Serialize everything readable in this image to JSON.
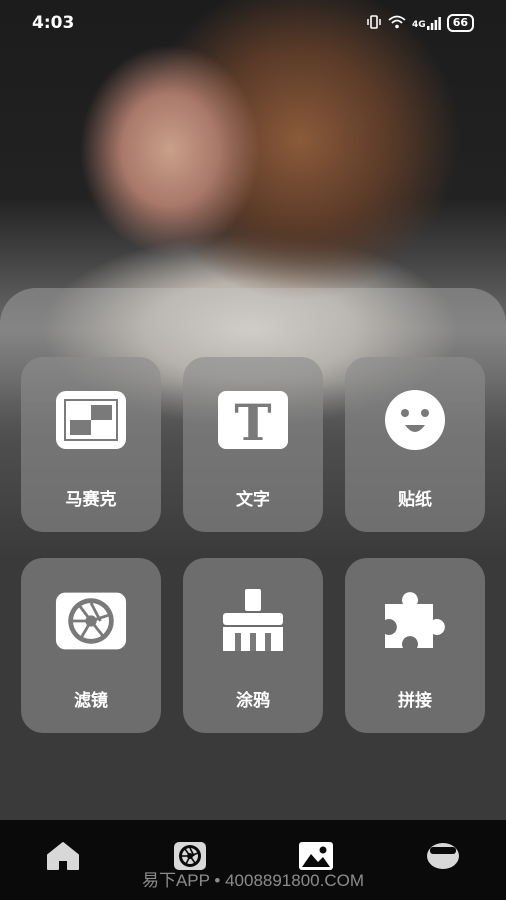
{
  "status_bar": {
    "time": "4:03",
    "network": "4G",
    "battery": "66"
  },
  "tools": [
    {
      "label": "马赛克",
      "icon": "mosaic-icon"
    },
    {
      "label": "文字",
      "icon": "text-icon",
      "glyph": "T"
    },
    {
      "label": "贴纸",
      "icon": "smiley-sticker-icon"
    },
    {
      "label": "滤镜",
      "icon": "aperture-filter-icon"
    },
    {
      "label": "涂鸦",
      "icon": "brush-icon"
    },
    {
      "label": "拼接",
      "icon": "puzzle-icon"
    }
  ],
  "nav": [
    {
      "icon": "home-icon"
    },
    {
      "icon": "aperture-icon"
    },
    {
      "icon": "image-icon",
      "active": true
    },
    {
      "icon": "profile-icon"
    }
  ],
  "watermark": "易下APP • 4008891800.COM"
}
